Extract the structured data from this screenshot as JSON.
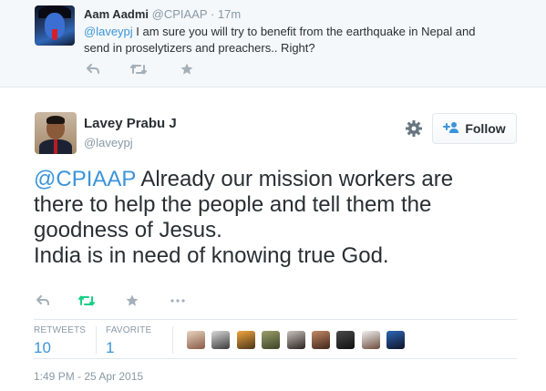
{
  "parent_tweet": {
    "name": "Aam Aadmi",
    "handle": "@CPIAAP",
    "separator": "·",
    "time": "17m",
    "mention": "@laveypj",
    "text_line1": " I am sure you will try to benefit from the earthquake in Nepal and",
    "text_line2": "send in proselytizers and preachers.. Right?"
  },
  "main_tweet": {
    "name": "Lavey Prabu J",
    "handle": "@laveypj",
    "follow_label": "Follow",
    "mention": "@CPIAAP",
    "text_line1": " Already our mission workers are",
    "text_line2": "there to help the people and tell them the",
    "text_line3": "goodness of Jesus.",
    "text_line4": "India is in need of knowing true God.",
    "retweets_label": "RETWEETS",
    "retweets_count": "10",
    "favorites_label": "FAVORITE",
    "favorites_count": "1",
    "timestamp": "1:49 PM - 25 Apr 2015"
  },
  "icons": [
    "reply-icon",
    "retweet-icon",
    "favorite-icon",
    "more-icon",
    "gear-icon",
    "follow-person-icon"
  ],
  "colors": {
    "link_blue": "#3b94d9",
    "retweet_green": "#19cf86",
    "muted_gray": "#8899a6",
    "icon_gray": "#a4b0b9",
    "text_dark": "#292f33",
    "parent_bg": "#f5f8fa"
  }
}
